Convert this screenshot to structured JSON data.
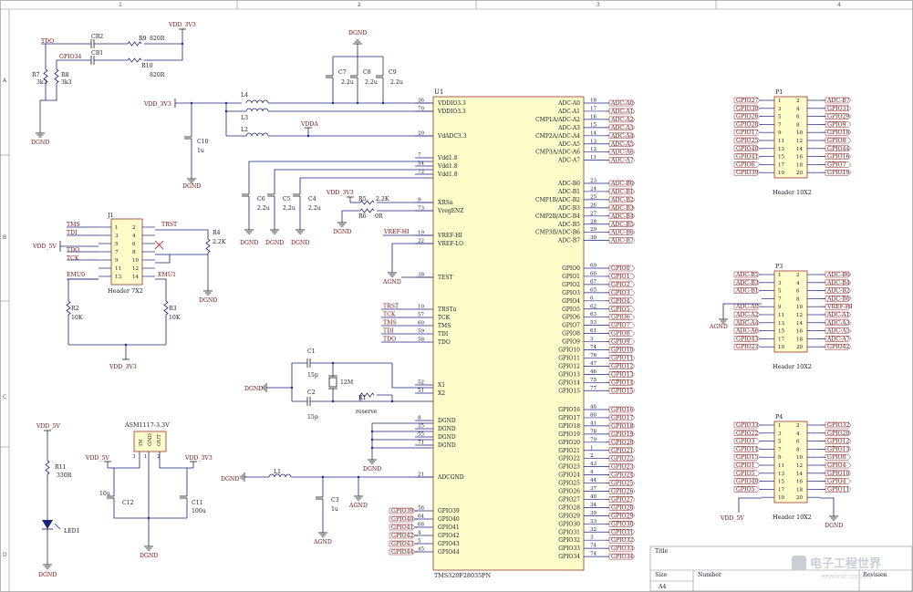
{
  "frame": {
    "columns": [
      "1",
      "2",
      "3",
      "4"
    ],
    "rows": [
      "A",
      "B",
      "C",
      "D"
    ],
    "title_label": "Title",
    "size_label": "Size",
    "size_value": "A4",
    "number_label": "Number",
    "revision_label": "Revision"
  },
  "watermark": {
    "name": "电子工程世界",
    "url": "eeworld.com.cn"
  },
  "u1": {
    "ref": "U1",
    "part": "TMS320F28035PN",
    "left_pins": [
      {
        "num": "36",
        "name": "VDDIO3.3"
      },
      {
        "num": "70",
        "name": "VDDIO3.3"
      },
      {
        "num": "20",
        "name": "VdADC3.3"
      },
      {
        "num": "7",
        "name": "Vdd1.8"
      },
      {
        "num": "54",
        "name": "Vdd1.8"
      },
      {
        "num": "72",
        "name": "Vdd1.8"
      },
      {
        "num": "9",
        "name": "XRSn"
      },
      {
        "num": "73",
        "name": "VregENZ"
      },
      {
        "num": "19",
        "name": "VREF-HI"
      },
      {
        "num": "22",
        "name": "VREF-LO"
      },
      {
        "num": "38",
        "name": "TEST"
      },
      {
        "num": "10",
        "name": "TRSTn"
      },
      {
        "num": "57",
        "name": "TCK"
      },
      {
        "num": "60",
        "name": "TMS"
      },
      {
        "num": "59",
        "name": "TDI"
      },
      {
        "num": "58",
        "name": "TDO"
      },
      {
        "num": "52",
        "name": "X1"
      },
      {
        "num": "51",
        "name": "X2"
      },
      {
        "num": "8",
        "name": "DGND"
      },
      {
        "num": "35",
        "name": "DGND"
      },
      {
        "num": "55",
        "name": "DGND"
      },
      {
        "num": "71",
        "name": "DGND"
      },
      {
        "num": "21",
        "name": "ADCGND"
      },
      {
        "num": "56",
        "name": "GPIO39"
      },
      {
        "num": "64",
        "name": "GPIO40"
      },
      {
        "num": "68",
        "name": "GPIO41"
      },
      {
        "num": "4",
        "name": "GPIO42"
      },
      {
        "num": "5",
        "name": "GPIO43"
      },
      {
        "num": "45",
        "name": "GPIO44"
      }
    ],
    "right_pins": [
      {
        "num": "18",
        "name": "ADC-A0",
        "net": "ADC-A0"
      },
      {
        "num": "17",
        "name": "ADC-A1",
        "net": "ADC-A1"
      },
      {
        "num": "16",
        "name": "CMP1A/ADC-A2",
        "net": "ADC-A2"
      },
      {
        "num": "15",
        "name": "ADC-A3",
        "net": "ADC-A3"
      },
      {
        "num": "14",
        "name": "CMP2A/ADC-A4",
        "net": "ADC-A4"
      },
      {
        "num": "13",
        "name": "ADC-A5",
        "net": "ADC-A5"
      },
      {
        "num": "12",
        "name": "CMP3A/ADC-A6",
        "net": "ADC-A6"
      },
      {
        "num": "11",
        "name": "ADC-A7",
        "net": "ADC-A7"
      },
      {
        "num": "23",
        "name": "ADC-B0",
        "net": "ADC-B0"
      },
      {
        "num": "24",
        "name": "ADC-B1",
        "net": "ADC-B1"
      },
      {
        "num": "25",
        "name": "CMP1B/ADC-B2",
        "net": "ADC-B2"
      },
      {
        "num": "26",
        "name": "ADC-B3",
        "net": "ADC-B3"
      },
      {
        "num": "27",
        "name": "CMP2B/ADC-B4",
        "net": "ADC-B4"
      },
      {
        "num": "28",
        "name": "ADC-B5",
        "net": "ADC-B5"
      },
      {
        "num": "29",
        "name": "CMP3B/ADC-B6",
        "net": "ADC-B6"
      },
      {
        "num": "30",
        "name": "ADC-B7",
        "net": "ADC-B7"
      },
      {
        "num": "69",
        "name": "GPIO0",
        "net": "GPIO0"
      },
      {
        "num": "66",
        "name": "GPIO1",
        "net": "GPIO1"
      },
      {
        "num": "67",
        "name": "GPIO2",
        "net": "GPIO2"
      },
      {
        "num": "65",
        "name": "GPIO3",
        "net": "GPIO3"
      },
      {
        "num": "6",
        "name": "GPIO4",
        "net": "GPIO4"
      },
      {
        "num": "62",
        "name": "GPIO5",
        "net": "GPIO5"
      },
      {
        "num": "63",
        "name": "GPIO6",
        "net": "GPIO6"
      },
      {
        "num": "53",
        "name": "GPIO7",
        "net": "GPIO7"
      },
      {
        "num": "61",
        "name": "GPIO8",
        "net": "GPIO8"
      },
      {
        "num": "3",
        "name": "GPIO9",
        "net": "GPIO9"
      },
      {
        "num": "74",
        "name": "GPIO10",
        "net": "GPIO10"
      },
      {
        "num": "76",
        "name": "GPIO11",
        "net": "GPIO11"
      },
      {
        "num": "47",
        "name": "GPIO12",
        "net": "GPIO12"
      },
      {
        "num": "46",
        "name": "GPIO13",
        "net": "GPIO13"
      },
      {
        "num": "75",
        "name": "GPIO14",
        "net": "GPIO14"
      },
      {
        "num": "77",
        "name": "GPIO15",
        "net": "GPIO15"
      },
      {
        "num": "46",
        "name": "GPIO16",
        "net": "GPIO16"
      },
      {
        "num": "80",
        "name": "GPIO17",
        "net": "GPIO17"
      },
      {
        "num": "41",
        "name": "GPIO18",
        "net": "GPIO18"
      },
      {
        "num": "78",
        "name": "GPIO19",
        "net": "GPIO19"
      },
      {
        "num": "79",
        "name": "GPIO20",
        "net": "GPIO20"
      },
      {
        "num": "1",
        "name": "GPIO21",
        "net": "GPIO21"
      },
      {
        "num": "2",
        "name": "GPIO22",
        "net": "GPIO22"
      },
      {
        "num": "43",
        "name": "GPIO23",
        "net": "GPIO23"
      },
      {
        "num": "4",
        "name": "GPIO24",
        "net": "GPIO24"
      },
      {
        "num": "44",
        "name": "GPIO25",
        "net": "GPIO25"
      },
      {
        "num": "37",
        "name": "GPIO26",
        "net": "GPIO26"
      },
      {
        "num": "40",
        "name": "GPIO27",
        "net": "GPIO27"
      },
      {
        "num": "34",
        "name": "GPIO28",
        "net": "GPIO28"
      },
      {
        "num": "39",
        "name": "GPIO29",
        "net": "GPIO29"
      },
      {
        "num": "33",
        "name": "GPIO30",
        "net": "GPIO30"
      },
      {
        "num": "32",
        "name": "GPIO31",
        "net": "GPIO31"
      },
      {
        "num": "3",
        "name": "GPIO32",
        "net": "GPIO32"
      },
      {
        "num": "74",
        "name": "GPIO33",
        "net": "GPIO33"
      },
      {
        "num": "74",
        "name": "GPIO34",
        "net": "GPIO34"
      }
    ],
    "left_nets": {
      "ref_hi": "VREF-HI",
      "trst": "TRST",
      "tck": "TCK",
      "tms": "TMS",
      "tdi": "TDI",
      "tdo": "TDO",
      "gpio_left": [
        "GPIO39",
        "GPIO40",
        "GPIO41",
        "GPIO42",
        "GPIO43",
        "GPIO44"
      ]
    }
  },
  "power": {
    "vdd33_top": "VDD_3V3",
    "vdd33_left": "VDD_3V3",
    "vdda": "VDDA",
    "dgnd": "DGND",
    "agnd": "AGND",
    "vdd5": "VDD_5V",
    "vdd33_j1": "VDD_3V3",
    "vdd33_xrs": "VDD_3V3",
    "vdd5_p4": "VDD_5V"
  },
  "top_left": {
    "tdo": "TDO",
    "gpio34": "GPIO34",
    "cb2": "CB2",
    "cb1": "CB1",
    "r9": "R9",
    "r9v": "820R",
    "r10": "R10",
    "r10v": "820R",
    "r7": "R7",
    "r7v": "3k3",
    "r8": "R8",
    "r8v": "3k3"
  },
  "caps": {
    "c7": "C7",
    "c8": "C8",
    "c9": "C9",
    "c789v": "2.2u",
    "c10": "C10",
    "c10v": "1u",
    "c6": "C6",
    "c5": "C5",
    "c4": "C4",
    "c456v": "2.2u",
    "c1": "C1",
    "c1v": "15p",
    "c2": "C2",
    "c2v": "15p",
    "c3": "C3",
    "c3v": "1u",
    "c12": "C12",
    "c12v": "10u",
    "c11": "C11",
    "c11v": "100u"
  },
  "inductors": {
    "l4": "L4",
    "l3": "L3",
    "l2": "L2",
    "l1": "L1"
  },
  "resistors": {
    "r5": "R5",
    "r5v": "2.2K",
    "r6": "R6",
    "r6v": "0R",
    "r4": "R4",
    "r4v": "2.2K",
    "r2": "R2",
    "r2v": "10K",
    "r3": "R3",
    "r3v": "10K",
    "r1": "R1",
    "r1v": "reserve",
    "r11": "R11",
    "r11v": "330R"
  },
  "crystal": {
    "ref": "12M"
  },
  "j1": {
    "ref": "J1",
    "part": "Header 7X2",
    "pins_left": [
      "1",
      "3",
      "5",
      "7",
      "9",
      "11",
      "13"
    ],
    "pins_right": [
      "2",
      "4",
      "6",
      "8",
      "10",
      "12",
      "14"
    ],
    "nets": {
      "tms": "TMS",
      "tdi": "TDI",
      "tdo": "TDO",
      "tck": "TCK",
      "emu0": "EMU0",
      "trst": "TRST",
      "emu1": "EMU1"
    }
  },
  "reg": {
    "ref": "ASM1117-3.3V",
    "pin_in": "IN",
    "pin_gnd": "GND",
    "pin_out": "OUT",
    "n3": "3",
    "n1": "1",
    "n2": "2"
  },
  "led": {
    "ref": "LED1"
  },
  "p1": {
    "ref": "P1",
    "part": "Header 10X2",
    "left": [
      "GPIO27",
      "GPIO30",
      "GPIO26",
      "GPIO28",
      "GPIO17",
      "GPIO25",
      "GPIO40",
      "GPIO41",
      "GPIO6",
      "GPIO39"
    ],
    "right": [
      "ADC-B7",
      "GPIO31",
      "GPIO29",
      "GPIO9",
      "GPIO18",
      "GPIO8",
      "GPIO44",
      "GPIO16",
      "GPIO7",
      "GPIO19"
    ]
  },
  "p3": {
    "ref": "P3",
    "part": "Header 10X2",
    "left": [
      "ADC-B5",
      "ADC-B3",
      "ADC-B1",
      "",
      "ADC-A0",
      "ADC-A2",
      "ADC-A4",
      "ADC-A6",
      "GPIO43",
      "GPIO23"
    ],
    "right": [
      "ADC-B6",
      "ADC-B4",
      "ADC-B2",
      "ADC-B0",
      "VREF-HI",
      "ADC-A1",
      "ADC-A3",
      "ADC-A5",
      "ADC-A7",
      "GPIO42"
    ]
  },
  "p4": {
    "ref": "P4",
    "part": "Header 10X2",
    "left": [
      "GPIO33",
      "GPIO22",
      "GPIO3",
      "GPIO14",
      "GPIO15",
      "GPIO1",
      "GPIO5",
      "GPIO40",
      "GPIO5",
      ""
    ],
    "right": [
      "GPIO32",
      "GPIO20",
      "GPIO12",
      "GPIO13",
      "GPIO0",
      "GPIO4",
      "GPIO10",
      "GPIO4",
      "GPIO11",
      ""
    ]
  },
  "header_pin_nums": {
    "left": [
      "1",
      "3",
      "5",
      "7",
      "9",
      "11",
      "13",
      "15",
      "17",
      "19"
    ],
    "right": [
      "2",
      "4",
      "6",
      "8",
      "10",
      "12",
      "14",
      "16",
      "18",
      "20"
    ]
  }
}
